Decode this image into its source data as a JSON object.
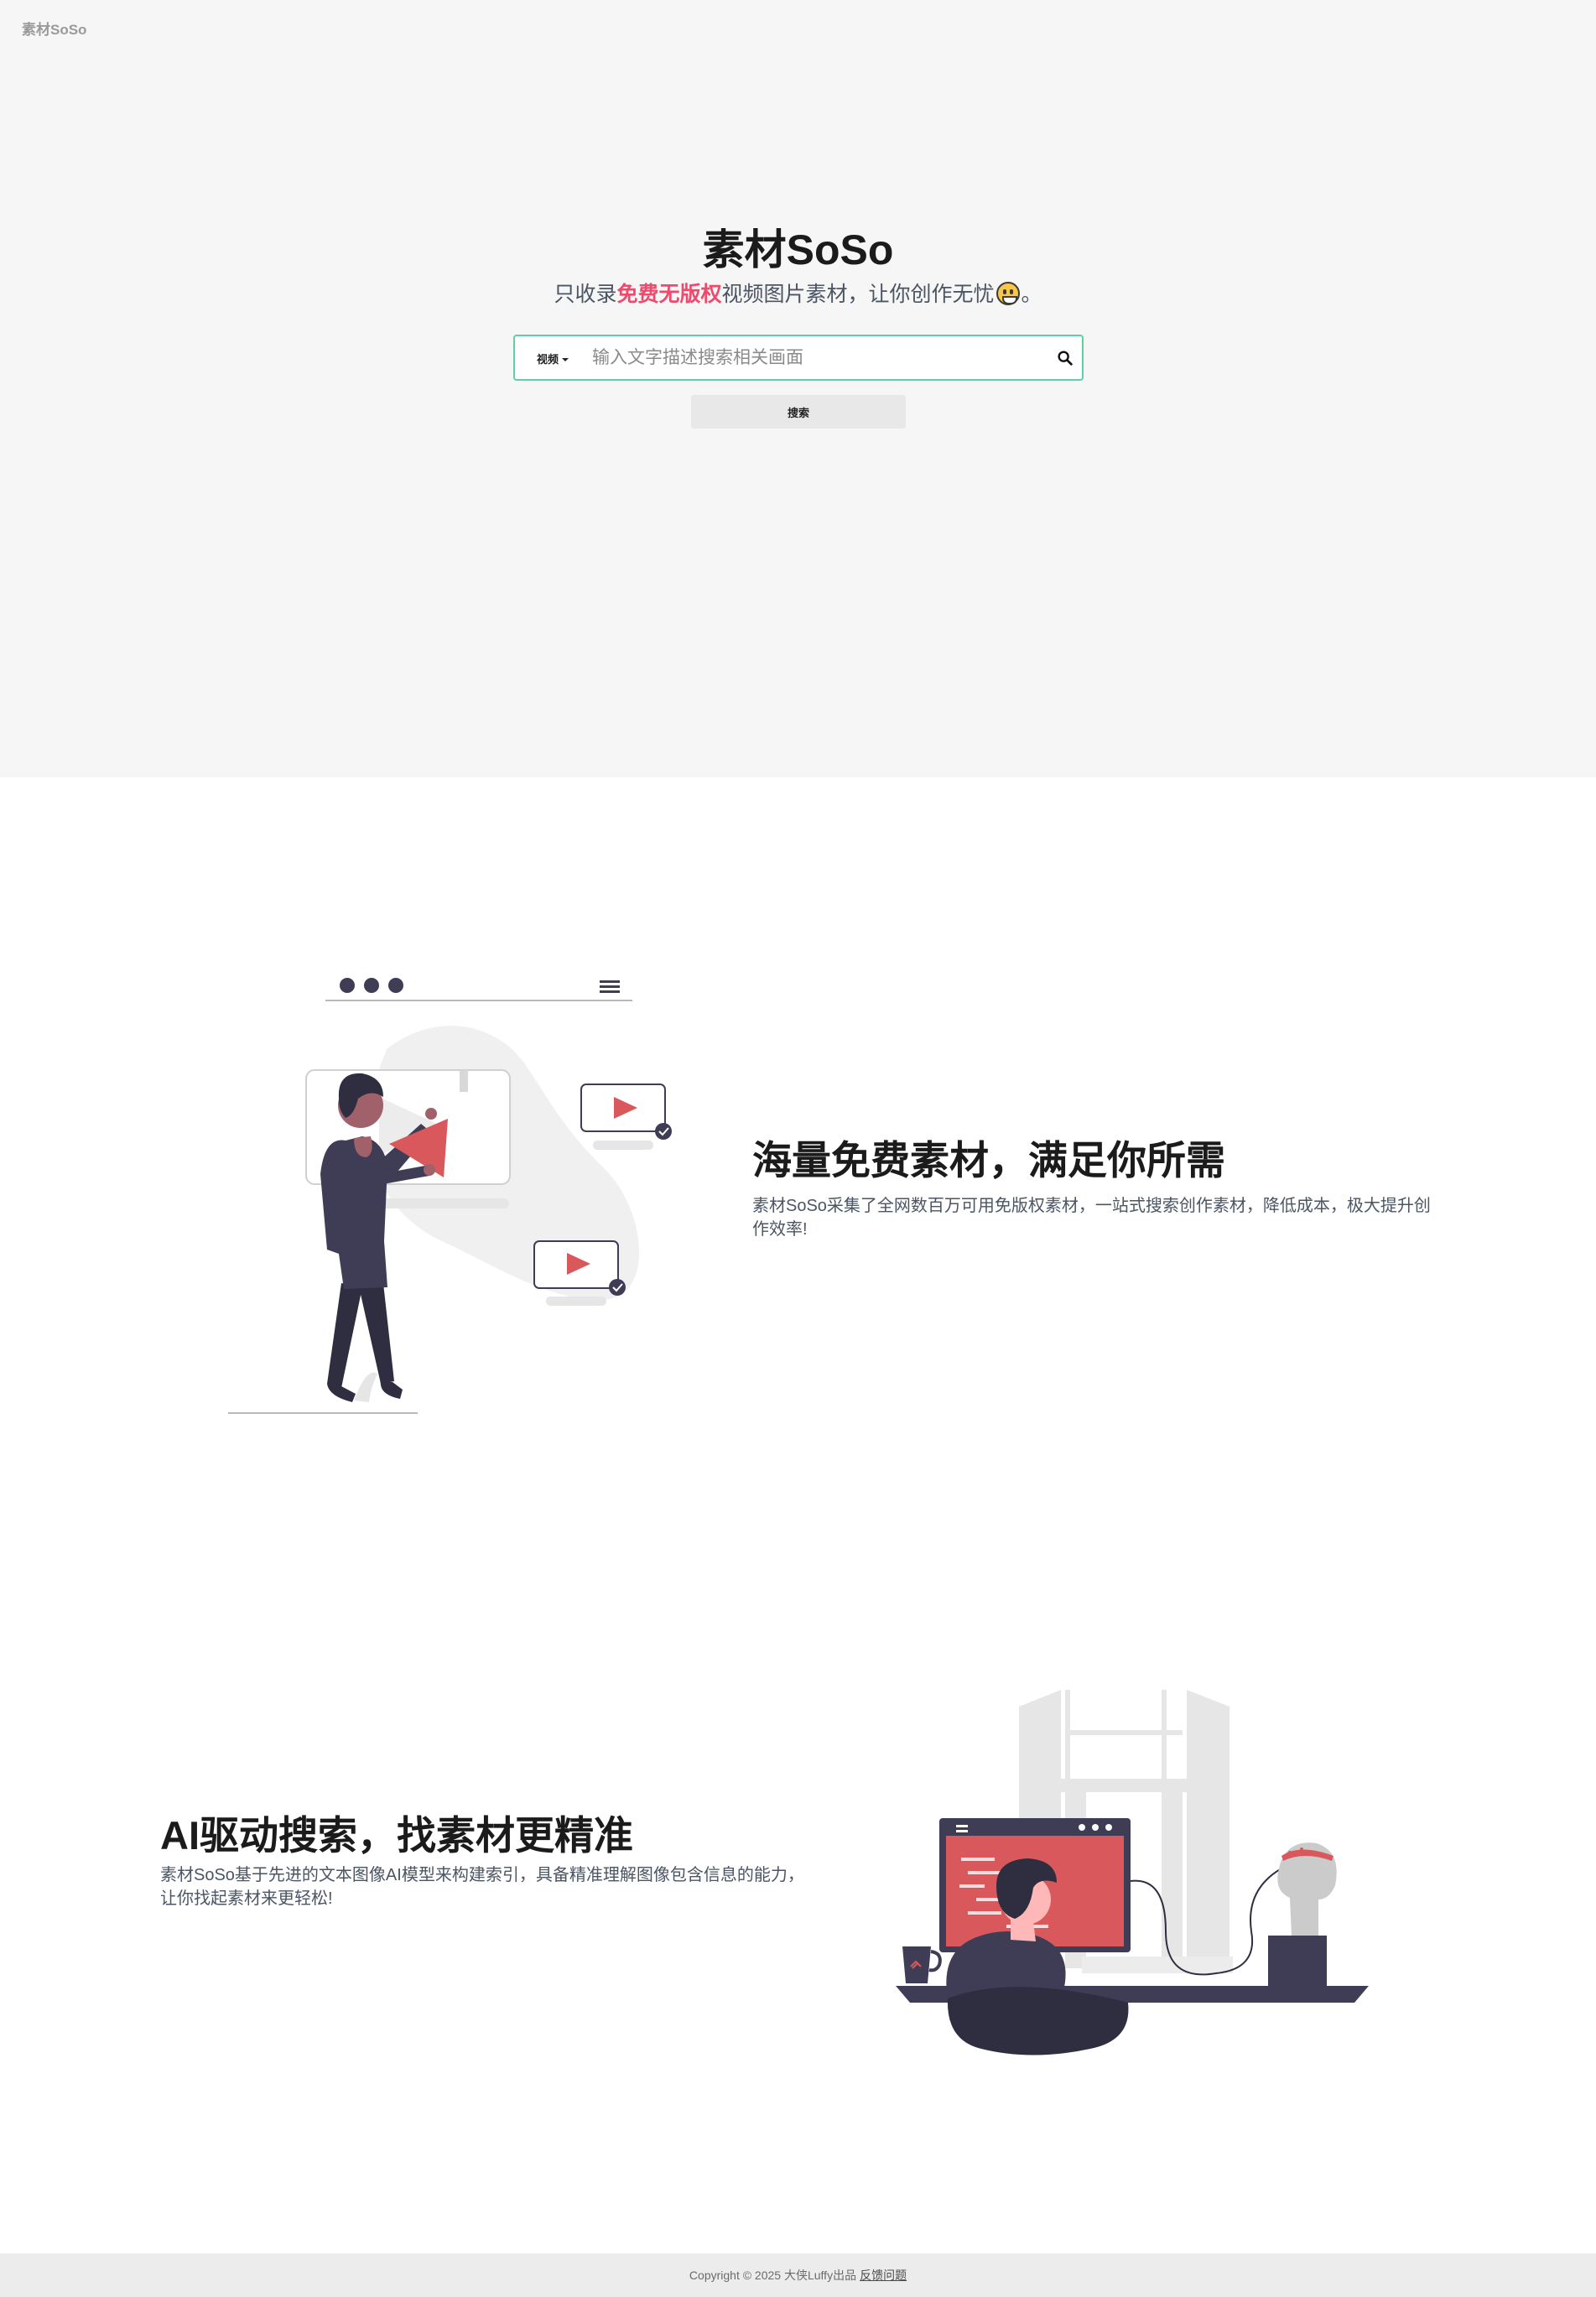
{
  "brand": {
    "logo": "素材SoSo",
    "title": "素材SoSo"
  },
  "hero": {
    "subtitle_before": "只收录",
    "subtitle_highlight": "免费无版权",
    "subtitle_after": "视频图片素材，让你创作无忧",
    "subtitle_end": "。",
    "highlight_color": "#ef4a6d"
  },
  "search": {
    "type_selected": "视频",
    "placeholder": "输入文字描述搜索相关画面",
    "button_label": "搜索",
    "border_color": "#5fd0a4"
  },
  "features": [
    {
      "title": "海量免费素材，满足你所需",
      "description": "素材SoSo采集了全网数百万可用免版权素材，一站式搜索创作素材，降低成本，极大提升创作效率!"
    },
    {
      "title": "AI驱动搜索，找素材更精准",
      "description": "素材SoSo基于先进的文本图像AI模型来构建索引，具备精准理解图像包含信息的能力，让你找起素材来更轻松!"
    }
  ],
  "footer": {
    "copyright": "Copyright © 2025 大侠Luffy出品",
    "feedback_link": "反馈问题"
  },
  "colors": {
    "accent_red": "#d9585b",
    "ink": "#3f3d56"
  }
}
